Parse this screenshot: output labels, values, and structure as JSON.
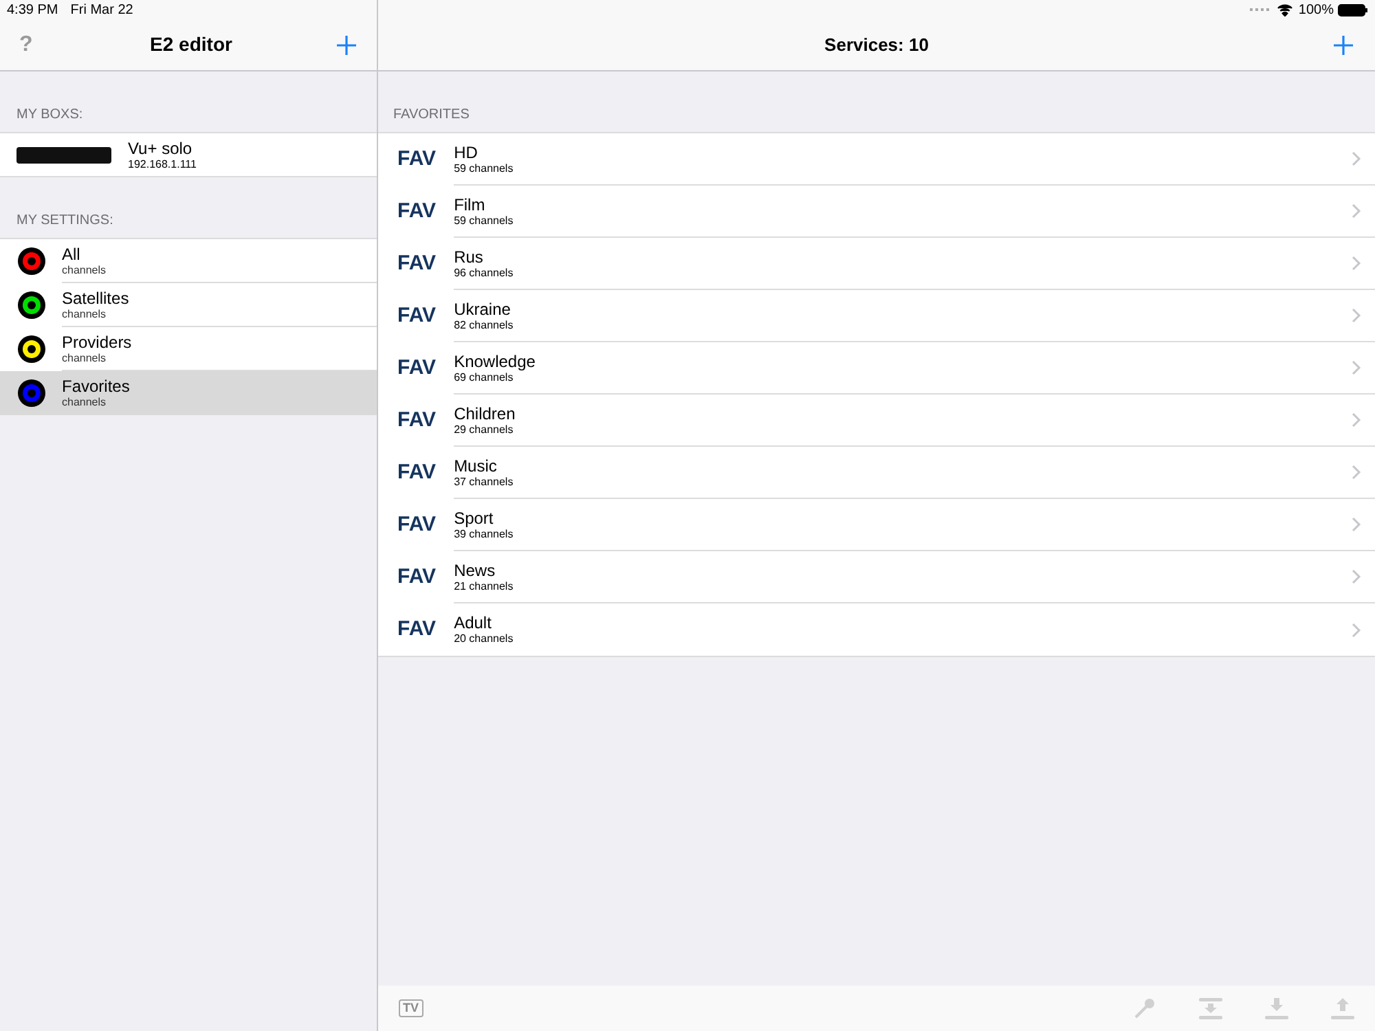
{
  "status_bar": {
    "time": "4:39 PM",
    "date": "Fri Mar 22",
    "battery": "100%"
  },
  "left": {
    "help": "?",
    "title": "E2 editor",
    "boxes_header": "MY BOXS:",
    "boxes": [
      {
        "name": "Vu+ solo",
        "address": "192.168.1.111"
      }
    ],
    "settings_header": "MY SETTINGS:",
    "settings": [
      {
        "name": "All",
        "subtitle": "channels",
        "color": "#ff0000",
        "selected": false
      },
      {
        "name": "Satellites",
        "subtitle": "channels",
        "color": "#00dd00",
        "selected": false
      },
      {
        "name": "Providers",
        "subtitle": "channels",
        "color": "#ffee00",
        "selected": false
      },
      {
        "name": "Favorites",
        "subtitle": "channels",
        "color": "#0000ff",
        "selected": true
      }
    ]
  },
  "right": {
    "title": "Services: 10",
    "section": "FAVORITES",
    "items": [
      {
        "badge": "FAV",
        "name": "HD",
        "count": "59 channels"
      },
      {
        "badge": "FAV",
        "name": "Film",
        "count": "59 channels"
      },
      {
        "badge": "FAV",
        "name": "Rus",
        "count": "96 channels"
      },
      {
        "badge": "FAV",
        "name": "Ukraine",
        "count": "82 channels"
      },
      {
        "badge": "FAV",
        "name": "Knowledge",
        "count": "69 channels"
      },
      {
        "badge": "FAV",
        "name": "Children",
        "count": "29 channels"
      },
      {
        "badge": "FAV",
        "name": "Music",
        "count": "37 channels"
      },
      {
        "badge": "FAV",
        "name": "Sport",
        "count": "39 channels"
      },
      {
        "badge": "FAV",
        "name": "News",
        "count": "21 channels"
      },
      {
        "badge": "FAV",
        "name": "Adult",
        "count": "20 channels"
      }
    ],
    "toolbar": {
      "tv": "TV"
    }
  }
}
